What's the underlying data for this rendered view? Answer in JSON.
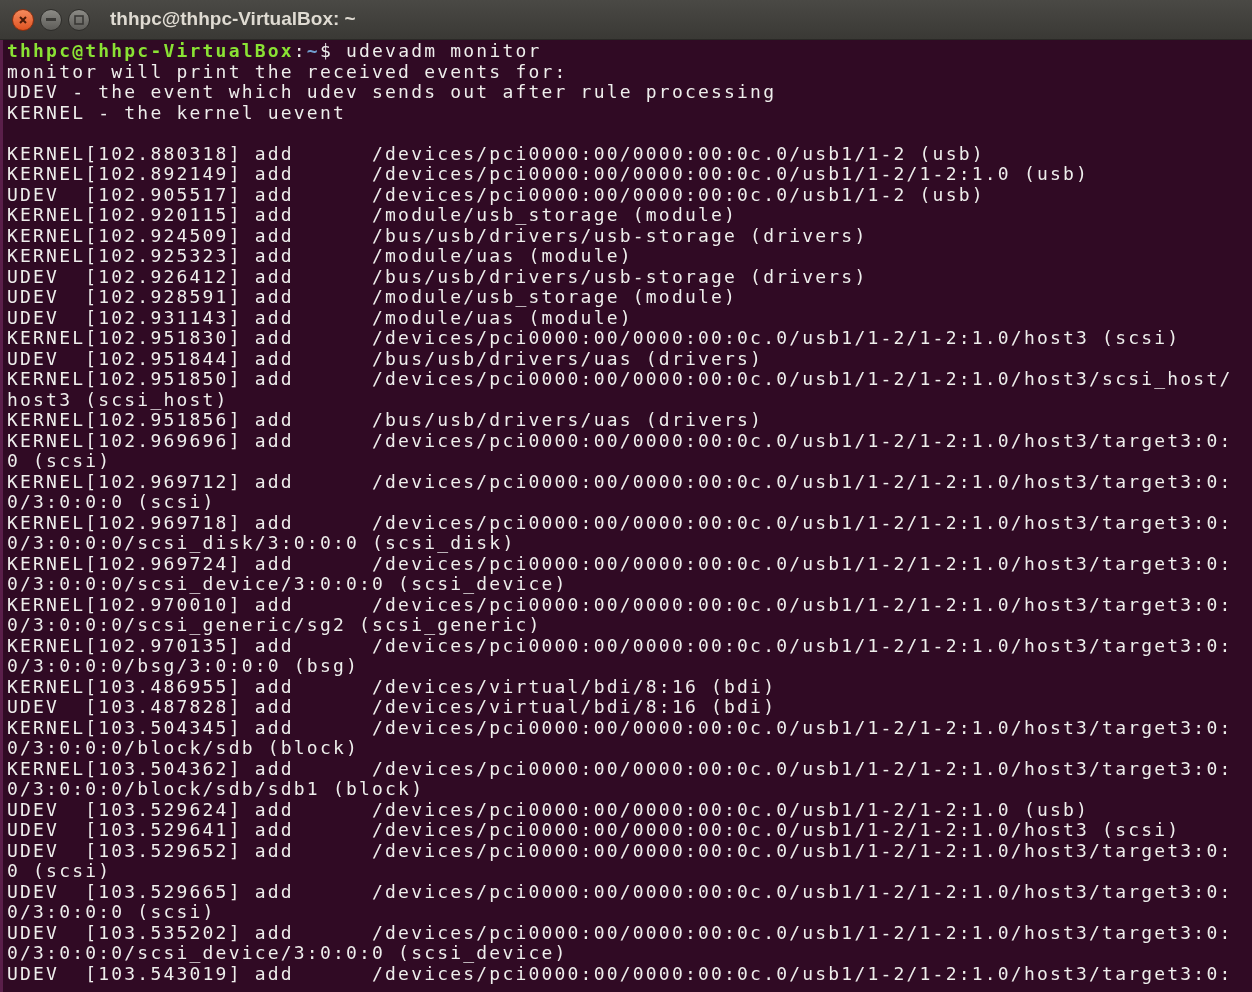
{
  "window": {
    "title": "thhpc@thhpc-VirtualBox: ~"
  },
  "prompt": {
    "user_host": "thhpc@thhpc-VirtualBox",
    "separator": ":",
    "path": "~",
    "symbol": "$",
    "command": "udevadm monitor"
  },
  "header_lines": [
    "monitor will print the received events for:",
    "UDEV - the event which udev sends out after rule processing",
    "KERNEL - the kernel uevent"
  ],
  "event_lines": [
    "KERNEL[102.880318] add      /devices/pci0000:00/0000:00:0c.0/usb1/1-2 (usb)",
    "KERNEL[102.892149] add      /devices/pci0000:00/0000:00:0c.0/usb1/1-2/1-2:1.0 (usb)",
    "UDEV  [102.905517] add      /devices/pci0000:00/0000:00:0c.0/usb1/1-2 (usb)",
    "KERNEL[102.920115] add      /module/usb_storage (module)",
    "KERNEL[102.924509] add      /bus/usb/drivers/usb-storage (drivers)",
    "KERNEL[102.925323] add      /module/uas (module)",
    "UDEV  [102.926412] add      /bus/usb/drivers/usb-storage (drivers)",
    "UDEV  [102.928591] add      /module/usb_storage (module)",
    "UDEV  [102.931143] add      /module/uas (module)",
    "KERNEL[102.951830] add      /devices/pci0000:00/0000:00:0c.0/usb1/1-2/1-2:1.0/host3 (scsi)",
    "UDEV  [102.951844] add      /bus/usb/drivers/uas (drivers)",
    "KERNEL[102.951850] add      /devices/pci0000:00/0000:00:0c.0/usb1/1-2/1-2:1.0/host3/scsi_host/",
    "host3 (scsi_host)",
    "KERNEL[102.951856] add      /bus/usb/drivers/uas (drivers)",
    "KERNEL[102.969696] add      /devices/pci0000:00/0000:00:0c.0/usb1/1-2/1-2:1.0/host3/target3:0:",
    "0 (scsi)",
    "KERNEL[102.969712] add      /devices/pci0000:00/0000:00:0c.0/usb1/1-2/1-2:1.0/host3/target3:0:",
    "0/3:0:0:0 (scsi)",
    "KERNEL[102.969718] add      /devices/pci0000:00/0000:00:0c.0/usb1/1-2/1-2:1.0/host3/target3:0:",
    "0/3:0:0:0/scsi_disk/3:0:0:0 (scsi_disk)",
    "KERNEL[102.969724] add      /devices/pci0000:00/0000:00:0c.0/usb1/1-2/1-2:1.0/host3/target3:0:",
    "0/3:0:0:0/scsi_device/3:0:0:0 (scsi_device)",
    "KERNEL[102.970010] add      /devices/pci0000:00/0000:00:0c.0/usb1/1-2/1-2:1.0/host3/target3:0:",
    "0/3:0:0:0/scsi_generic/sg2 (scsi_generic)",
    "KERNEL[102.970135] add      /devices/pci0000:00/0000:00:0c.0/usb1/1-2/1-2:1.0/host3/target3:0:",
    "0/3:0:0:0/bsg/3:0:0:0 (bsg)",
    "KERNEL[103.486955] add      /devices/virtual/bdi/8:16 (bdi)",
    "UDEV  [103.487828] add      /devices/virtual/bdi/8:16 (bdi)",
    "KERNEL[103.504345] add      /devices/pci0000:00/0000:00:0c.0/usb1/1-2/1-2:1.0/host3/target3:0:",
    "0/3:0:0:0/block/sdb (block)",
    "KERNEL[103.504362] add      /devices/pci0000:00/0000:00:0c.0/usb1/1-2/1-2:1.0/host3/target3:0:",
    "0/3:0:0:0/block/sdb/sdb1 (block)",
    "UDEV  [103.529624] add      /devices/pci0000:00/0000:00:0c.0/usb1/1-2/1-2:1.0 (usb)",
    "UDEV  [103.529641] add      /devices/pci0000:00/0000:00:0c.0/usb1/1-2/1-2:1.0/host3 (scsi)",
    "UDEV  [103.529652] add      /devices/pci0000:00/0000:00:0c.0/usb1/1-2/1-2:1.0/host3/target3:0:",
    "0 (scsi)",
    "UDEV  [103.529665] add      /devices/pci0000:00/0000:00:0c.0/usb1/1-2/1-2:1.0/host3/target3:0:",
    "0/3:0:0:0 (scsi)",
    "UDEV  [103.535202] add      /devices/pci0000:00/0000:00:0c.0/usb1/1-2/1-2:1.0/host3/target3:0:",
    "0/3:0:0:0/scsi_device/3:0:0:0 (scsi_device)",
    "UDEV  [103.543019] add      /devices/pci0000:00/0000:00:0c.0/usb1/1-2/1-2:1.0/host3/target3:0:"
  ]
}
